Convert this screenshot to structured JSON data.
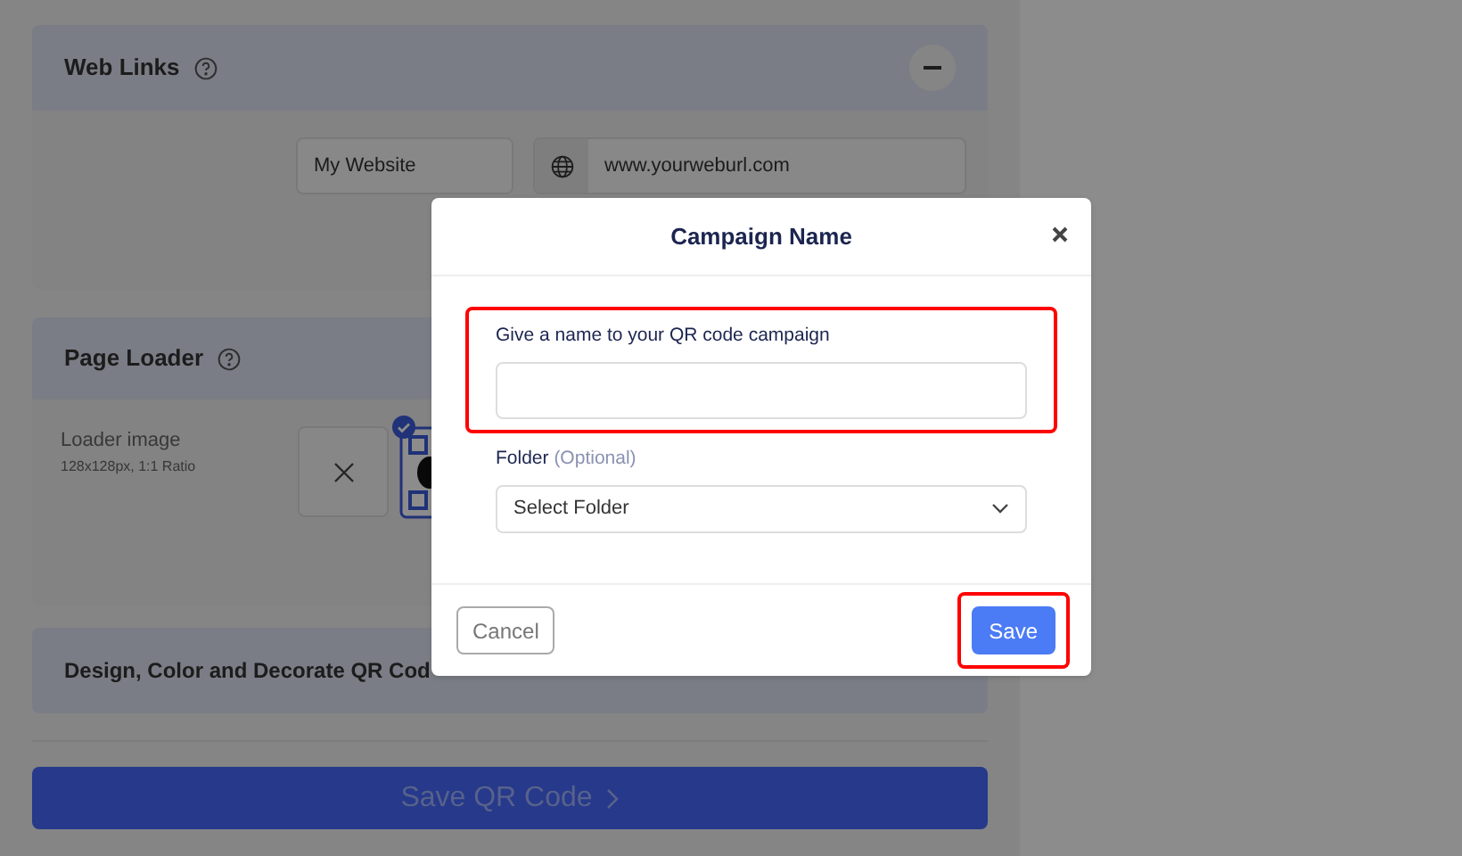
{
  "web_links": {
    "title": "Web Links",
    "name_value": "My Website",
    "url_value": "www.yourweburl.com"
  },
  "page_loader": {
    "title": "Page Loader",
    "image_label": "Loader image",
    "image_hint": "128x128px, 1:1 Ratio",
    "image_selected": true
  },
  "design_section": {
    "title": "Design, Color and Decorate QR Cod"
  },
  "save_qr_button": "Save QR Code",
  "dialog": {
    "title": "Campaign Name",
    "name_field": {
      "label": "Give a name to your QR code campaign",
      "highlighted": true
    },
    "folder_label": "Folder",
    "folder_hint": "(Optional)",
    "folder_select": "Select Folder",
    "buttons": [
      {
        "kind": "secondary",
        "label": "Cancel",
        "highlighted": false
      },
      {
        "kind": "primary",
        "label": "Save",
        "highlighted": true
      }
    ]
  }
}
